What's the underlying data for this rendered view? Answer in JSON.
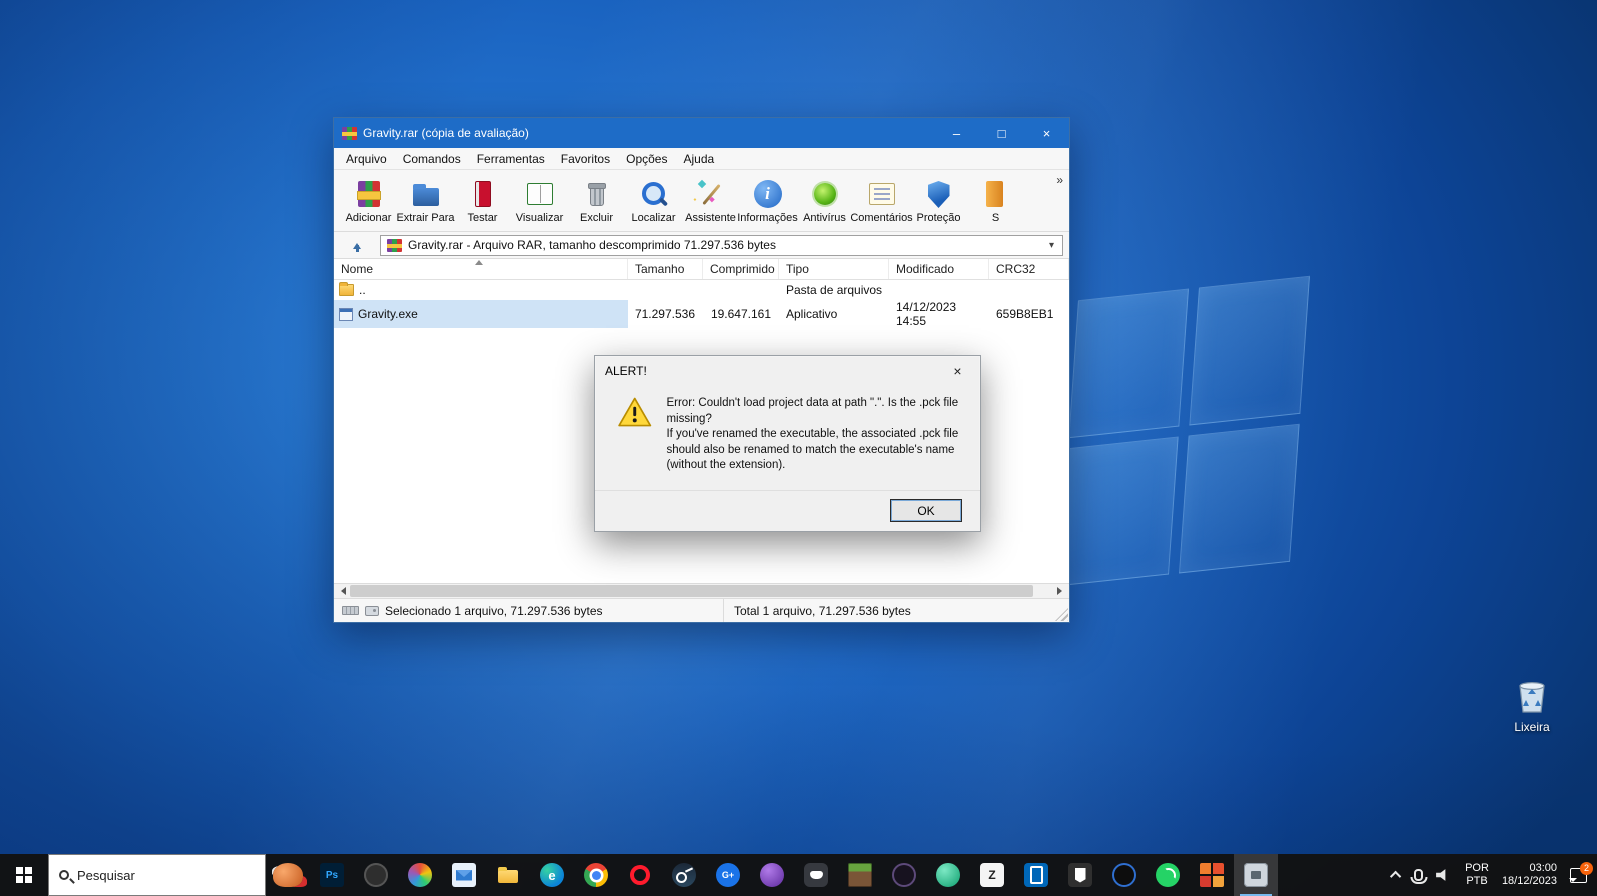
{
  "desktop": {
    "recycle_bin_label": "Lixeira"
  },
  "window": {
    "title": "Gravity.rar (cópia de avaliação)",
    "caption_buttons": {
      "minimize": "–",
      "maximize": "□",
      "close": "×"
    },
    "menu": [
      "Arquivo",
      "Comandos",
      "Ferramentas",
      "Favoritos",
      "Opções",
      "Ajuda"
    ],
    "toolbar": [
      {
        "label": "Adicionar",
        "icon": "add-books-icon"
      },
      {
        "label": "Extrair Para",
        "icon": "extract-folder-icon"
      },
      {
        "label": "Testar",
        "icon": "test-book-icon"
      },
      {
        "label": "Visualizar",
        "icon": "view-book-icon"
      },
      {
        "label": "Excluir",
        "icon": "delete-trash-icon"
      },
      {
        "label": "Localizar",
        "icon": "find-magnifier-icon"
      },
      {
        "label": "Assistente",
        "icon": "wizard-wand-icon"
      },
      {
        "label": "Informações",
        "icon": "info-icon"
      },
      {
        "label": "Antivírus",
        "icon": "antivirus-icon"
      },
      {
        "label": "Comentários",
        "icon": "comments-icon"
      },
      {
        "label": "Proteção",
        "icon": "protect-shield-icon"
      },
      {
        "label": "S",
        "icon": "sfx-partial-icon"
      }
    ],
    "toolbar_overflow": "»",
    "address": "Gravity.rar - Arquivo RAR, tamanho descomprimido 71.297.536 bytes",
    "address_dropdown": "▾",
    "columns": [
      "Nome",
      "Tamanho",
      "Comprimido",
      "Tipo",
      "Modificado",
      "CRC32"
    ],
    "rows": [
      {
        "name": "..",
        "size": "",
        "compressed": "",
        "type": "Pasta de arquivos",
        "modified": "",
        "crc": ""
      },
      {
        "name": "Gravity.exe",
        "size": "71.297.536",
        "compressed": "19.647.161",
        "type": "Aplicativo",
        "modified": "14/12/2023 14:55",
        "crc": "659B8EB1"
      }
    ],
    "status_left": "Selecionado 1 arquivo, 71.297.536 bytes",
    "status_right": "Total 1 arquivo, 71.297.536 bytes"
  },
  "dialog": {
    "title": "ALERT!",
    "close": "×",
    "line1": "Error: Couldn't load project data at path \".\". Is the .pck file missing?",
    "line2": "If you've renamed the executable, the associated .pck file should also be renamed to match the executable's name (without the extension).",
    "ok": "OK"
  },
  "taskbar": {
    "search_placeholder": "Pesquisar",
    "icons": [
      {
        "name": "festive-pet-icon",
        "glyph": ""
      },
      {
        "name": "photoshop-icon",
        "glyph": "Ps"
      },
      {
        "name": "dark-game-icon",
        "glyph": ""
      },
      {
        "name": "art-app-icon",
        "glyph": ""
      },
      {
        "name": "mail-icon",
        "glyph": ""
      },
      {
        "name": "file-explorer-icon",
        "glyph": ""
      },
      {
        "name": "edge-icon",
        "glyph": "e"
      },
      {
        "name": "chrome-icon",
        "glyph": ""
      },
      {
        "name": "opera-icon",
        "glyph": ""
      },
      {
        "name": "steam-icon",
        "glyph": ""
      },
      {
        "name": "g-plus-icon",
        "glyph": "G+"
      },
      {
        "name": "purple-app-icon",
        "glyph": ""
      },
      {
        "name": "discord-icon",
        "glyph": ""
      },
      {
        "name": "minecraft-icon",
        "glyph": ""
      },
      {
        "name": "gog-icon",
        "glyph": ""
      },
      {
        "name": "teal-app-icon",
        "glyph": ""
      },
      {
        "name": "white-z-icon",
        "glyph": "Z"
      },
      {
        "name": "your-phone-icon",
        "glyph": ""
      },
      {
        "name": "epic-games-icon",
        "glyph": ""
      },
      {
        "name": "dark-swirl-icon",
        "glyph": ""
      },
      {
        "name": "whatsapp-icon",
        "glyph": ""
      },
      {
        "name": "orange-grid-icon",
        "glyph": ""
      },
      {
        "name": "winrar-active-icon",
        "glyph": ""
      }
    ],
    "tray": {
      "lang1": "POR",
      "lang2": "PTB",
      "time": "03:00",
      "date": "18/12/2023",
      "badge": "2"
    }
  }
}
